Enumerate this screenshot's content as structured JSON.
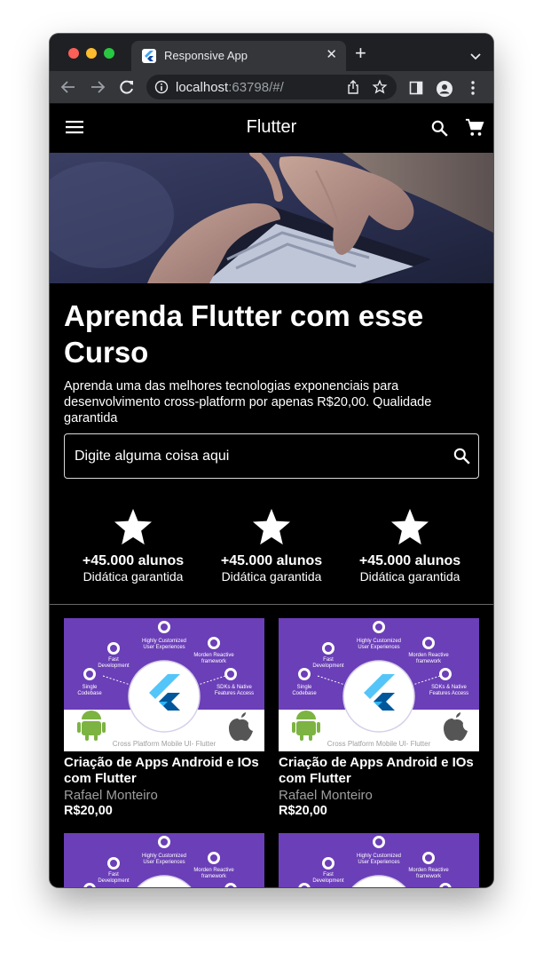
{
  "browser": {
    "tab_title": "Responsive App",
    "tab_close": "✕",
    "new_tab": "+",
    "url_host": "localhost",
    "url_rest": ":63798/#/"
  },
  "app": {
    "title": "Flutter",
    "headline": "Aprenda Flutter com esse Curso",
    "subtext": "Aprenda uma das melhores tecnologias exponenciais para desenvolvimento cross-platform por apenas R$20,00. Qualidade garantida",
    "search_placeholder": "Digite alguma coisa aqui",
    "features": [
      {
        "big": "+45.000 alunos",
        "small": "Didática garantida"
      },
      {
        "big": "+45.000 alunos",
        "small": "Didática garantida"
      },
      {
        "big": "+45.000 alunos",
        "small": "Didática garantida"
      }
    ],
    "courses": [
      {
        "title": "Criação de Apps Android e IOs com Flutter",
        "author": "Rafael Monteiro",
        "price": "R$20,00"
      },
      {
        "title": "Criação de Apps Android e IOs com Flutter",
        "author": "Rafael Monteiro",
        "price": "R$20,00"
      },
      {
        "title": "",
        "author": "",
        "price": ""
      },
      {
        "title": "",
        "author": "",
        "price": ""
      }
    ],
    "thumbnail_labels": {
      "fast": "Fast Development",
      "ux": "Highly Customized User Experiences",
      "reactive": "Morden Reactive framework",
      "single": "Single Codebase",
      "sdk": "SDKs & Native Features Access",
      "footer": "Cross Platform Mobile UI- Flutter"
    }
  },
  "colors": {
    "thumbnail_purple": "#6b3fb7",
    "app_background": "#000000",
    "text": "#ffffff"
  }
}
